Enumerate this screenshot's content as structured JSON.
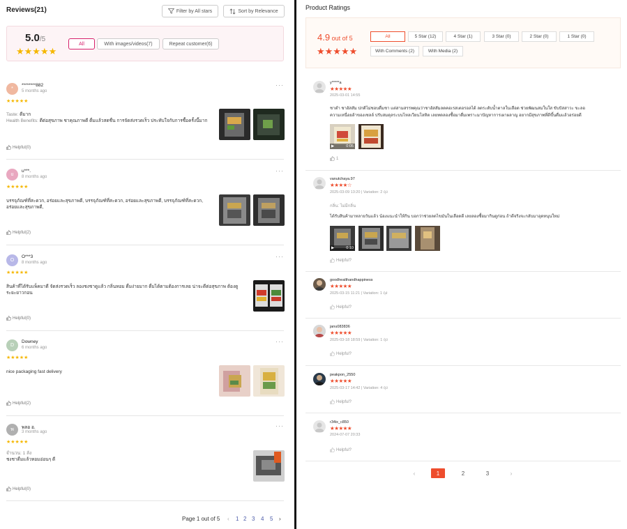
{
  "left": {
    "title": "Reviews(21)",
    "filter_label": "Filter by All stars",
    "sort_label": "Sort by Relevance",
    "score": "5.0",
    "score_of": "/5",
    "chips": [
      "All",
      "With images/videos(7)",
      "Repeat customer(6)"
    ],
    "reviews": [
      {
        "initial": "*",
        "avatar_color": "#f0b8a0",
        "name": "********882",
        "time": "5 months ago",
        "lines": [
          {
            "k": "Taste:",
            "v": " ดีมาก"
          },
          {
            "k": "Health Benefits:",
            "v": " ดีต่อสุขภาพ ชาคุณภาพดี ดื่มแล้วสดชื่น การจัดส่งรวดเร็ว ประทับใจกับการซื้อครั้งนี้มาก"
          }
        ],
        "helpful": "Helpful(0)"
      },
      {
        "initial": "u",
        "avatar_color": "#e9a8c0",
        "name": "u***.",
        "time": "8 months ago",
        "lines": [
          {
            "k": "",
            "v": "บรรจุภัณฑ์ที่สะดวก, อร่อยและสุขภาพดี, บรรจุภัณฑ์ที่สะดวก, อร่อยและสุขภาพดี, บรรจุภัณฑ์ที่สะดวก,"
          },
          {
            "k": "",
            "v": "อร่อยและสุขภาพดี,"
          }
        ],
        "helpful": "Helpful(2)"
      },
      {
        "initial": "O",
        "avatar_color": "#b8b8e8",
        "name": "O***3",
        "time": "8 months ago",
        "lines": [
          {
            "k": "",
            "v": "สินค้าที่ได้รับแพ็คมาดี จัดส่งรวดเร็ว ลองชงชาดูแล้ว กลิ่นหอม ดื่มง่ายมาก ดื่มได้ตามต้องการเลย น่าจะดีต่อสุขภาพ ต้องดู"
          },
          {
            "k": "",
            "v": "ระยะยาวกอน"
          }
        ],
        "helpful": "Helpful(0)"
      },
      {
        "initial": "D",
        "avatar_color": "#b8d0b8",
        "name": "Downey",
        "time": "6 months ago",
        "lines": [
          {
            "k": "",
            "v": "nice packaging fast delivery"
          }
        ],
        "helpful": "Helpful(2)"
      },
      {
        "initial": "พ",
        "avatar_color": "#b0b0b0",
        "name": "พลอ อ.",
        "time": "3 months ago",
        "lines": [
          {
            "k": "",
            "v": "จำนวน: 1 ลัง"
          },
          {
            "k": "",
            "v": "ชงชาดื่มแล้วหอมอ่อนๆ ดี"
          }
        ],
        "helpful": "Helpful(0)"
      }
    ],
    "pager": {
      "label": "Page 1 out of 5",
      "prev": "‹",
      "next": "›",
      "pages": [
        "1",
        "2",
        "3",
        "4",
        "5"
      ]
    }
  },
  "right": {
    "title": "Product Ratings",
    "score": "4.9",
    "score_of": " out of 5",
    "chips_row1": [
      "All",
      "5 Star (12)",
      "4 Star (1)",
      "3 Star (0)",
      "2 Star (0)",
      "1 Star (0)"
    ],
    "chips_row2": [
      "With Comments (2)",
      "With Media (2)"
    ],
    "ratings": [
      {
        "name": "y*****a",
        "stars": "★★★★★",
        "meta": "2025-03-01 14:55",
        "text": [
          "ชาดำ ชาอัสสัม ปกติไม่ชอบดื่มชา แต่สามสรรพคุณว่าชาอัสสัมลดคอเรสเตอรอลได้ ลดระดับน้ำตาลในเลือด ช่วยพัฒนสมในใส ขับปัสสาวะ ขะลอ",
          "ความเหนื่อยล้าของเซลล์ ปรับสมดุลระบบไหลเวียนโลหิต เลยทดลองซื้อมาดื่มเพราะมาปัญหาการเผาผลาญ อยากมีสุขภาพที่ดีขึ้นดื่มแล้วอร่อยดี"
        ],
        "like": "1",
        "video_time": "0:05"
      },
      {
        "name": "vanutchaya.97",
        "stars": "★★★★☆",
        "meta": "2025-03-09 13:20 | Variation: 2 ถุง",
        "text_k": "กลิ่น:",
        "text_v": " ไม่มีกลิ่น",
        "text": [
          "ได้รับสินค้ามาหลายวันแล้ว น้องแนะนำให้กิน บอกว่าช่วยลดไขมันในเลือดดี เลยลองซื้อมากินดูก่อน ถ้าดีจริงจะกลับมาอุดหนุนใหม่"
        ],
        "like": "Helpful?",
        "video_time": "0:10"
      },
      {
        "name": "goodhealthandhappiness",
        "stars": "★★★★★",
        "meta": "2025-03-15 11:21 | Variation: 1 ถุง",
        "like": "Helpful?"
      },
      {
        "name": "janu083836",
        "stars": "★★★★★",
        "meta": "2025-03-18 18:59 | Variation: 1 ถุง",
        "like": "Helpful?"
      },
      {
        "name": "peakpon_2550",
        "stars": "★★★★★",
        "meta": "2025-03-17 14:42 | Variation: 4 ถุง",
        "like": "Helpful?"
      },
      {
        "name": "r34ix_c850",
        "stars": "★★★★★",
        "meta": "2024-07-07 20:33",
        "like": "Helpful?"
      }
    ],
    "pager": {
      "prev": "‹",
      "next": "›",
      "pages": [
        "1",
        "2",
        "3"
      ]
    }
  },
  "colors": {
    "accent_left": "#d6206b",
    "accent_right": "#ee4d2d",
    "star_gold": "#f5b700"
  }
}
